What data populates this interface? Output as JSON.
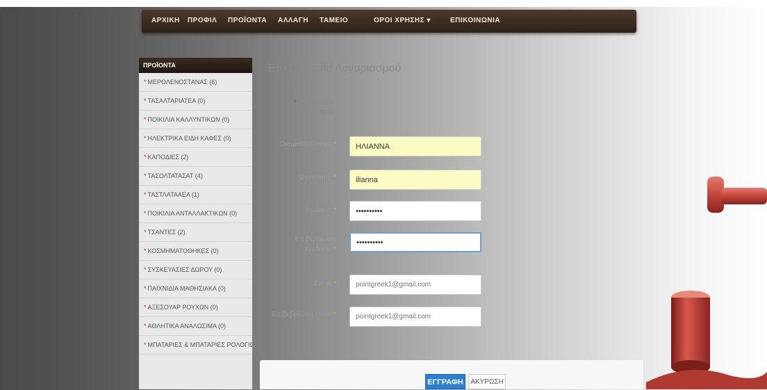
{
  "nav": {
    "items": [
      {
        "label": "ΑΡΧΙΚΗ"
      },
      {
        "label": "ΠΡΟΦΙΛ"
      },
      {
        "label": "ΠΡΟΪΟΝΤΑ"
      },
      {
        "label": "ΑΛΛΑΓΗ"
      },
      {
        "label": "ΤΑΜΕΙΟ"
      },
      {
        "label": "ΟΡΟΙ ΧΡΗΣΗΣ ▾"
      },
      {
        "label": "ΕΠΙΚΟΙΝΩΝΙΑ"
      }
    ]
  },
  "sidebar": {
    "title": "ΠΡΟΪΟΝΤΑ",
    "items": [
      {
        "label": "ΜΕΡΟΛΕΝΟΣΤΑΝΑΣ (6)"
      },
      {
        "label": "ΤΑΣΑΛΤΑΡΙΑΤΕΑ (0)"
      },
      {
        "label": "ΠΟΙΚΙΛΙΑ ΚΑΛΛΥΝΤΙΚΩΝ (0)"
      },
      {
        "label": "ΗΛΕΚΤΡΙΚΑ ΕΙΔΗ ΚΑΦΕΣ (0)"
      },
      {
        "label": "ΚΑΠΟΔΙΕΣ (2)"
      },
      {
        "label": "ΤΑΣΟΛΤΑΤΑΣΑΤ (4)"
      },
      {
        "label": "ΤΑΣΤΛΑΤΑΑΕΑ (1)"
      },
      {
        "label": "ΠΟΙΚΙΛΙΑ ΑΝΤΑΛΛΑΚΤΙΚΩΝ (0)"
      },
      {
        "label": "ΤΣΑΝΤΕΣ (2)"
      },
      {
        "label": "ΚΟΣΜΗΜΑΤΟΘΗΚΕΣ (0)"
      },
      {
        "label": "ΣΥΣΚΕΥΑΣΙΕΣ ΔΩΡΟΥ (0)"
      },
      {
        "label": "ΠΑΙΧΝΙΔΙΑ ΜΑΘΗΣΙΑΚΑ (0)"
      },
      {
        "label": "ΑΞΕΣΟΥΑΡ ΡΟΥΧΩΝ (0)"
      },
      {
        "label": "ΑΘΛΗΤΙΚΑ ΑΝΑΛΩΣΙΜΑ (0)"
      },
      {
        "label": "ΜΠΑΤΑΡΙΕΣ & ΜΠΑΤΑΡΙΕΣ ΡΟΛΟΓΙΩΝ"
      }
    ]
  },
  "form": {
    "title": "Επεξεργασία Λογαριασμού",
    "required_note": "Υποχρεωτικά πεδία",
    "required_star": "*",
    "fields": {
      "fullname": {
        "label": "Ονοματεπώνυμο",
        "value": "ΗΛΙΑΝΝΑ"
      },
      "username": {
        "label": "Username",
        "value": "ilianna"
      },
      "password": {
        "label": "Κωδικός",
        "value": "••••••••••"
      },
      "password_confirm": {
        "label": "Επιβεβαίωση Κωδικού",
        "value": "••••••••••"
      },
      "email": {
        "label": "Email",
        "value": "pointgreek1@gmail.com"
      },
      "email_confirm": {
        "label": "Επιβεβαίωση email",
        "value": "pointgreek1@gmail.com"
      }
    },
    "submit_label": "ΕΓΓΡΑΦΗ",
    "cancel_label": "ΑΚΥΡΩΣΗ"
  },
  "colors": {
    "nav_bg": "#3a2c20",
    "sidebar_bg": "#e9e9e9",
    "input_autofill": "#fbfbc4",
    "submit_bg": "#2a7fd4",
    "required_star": "#c62828"
  }
}
